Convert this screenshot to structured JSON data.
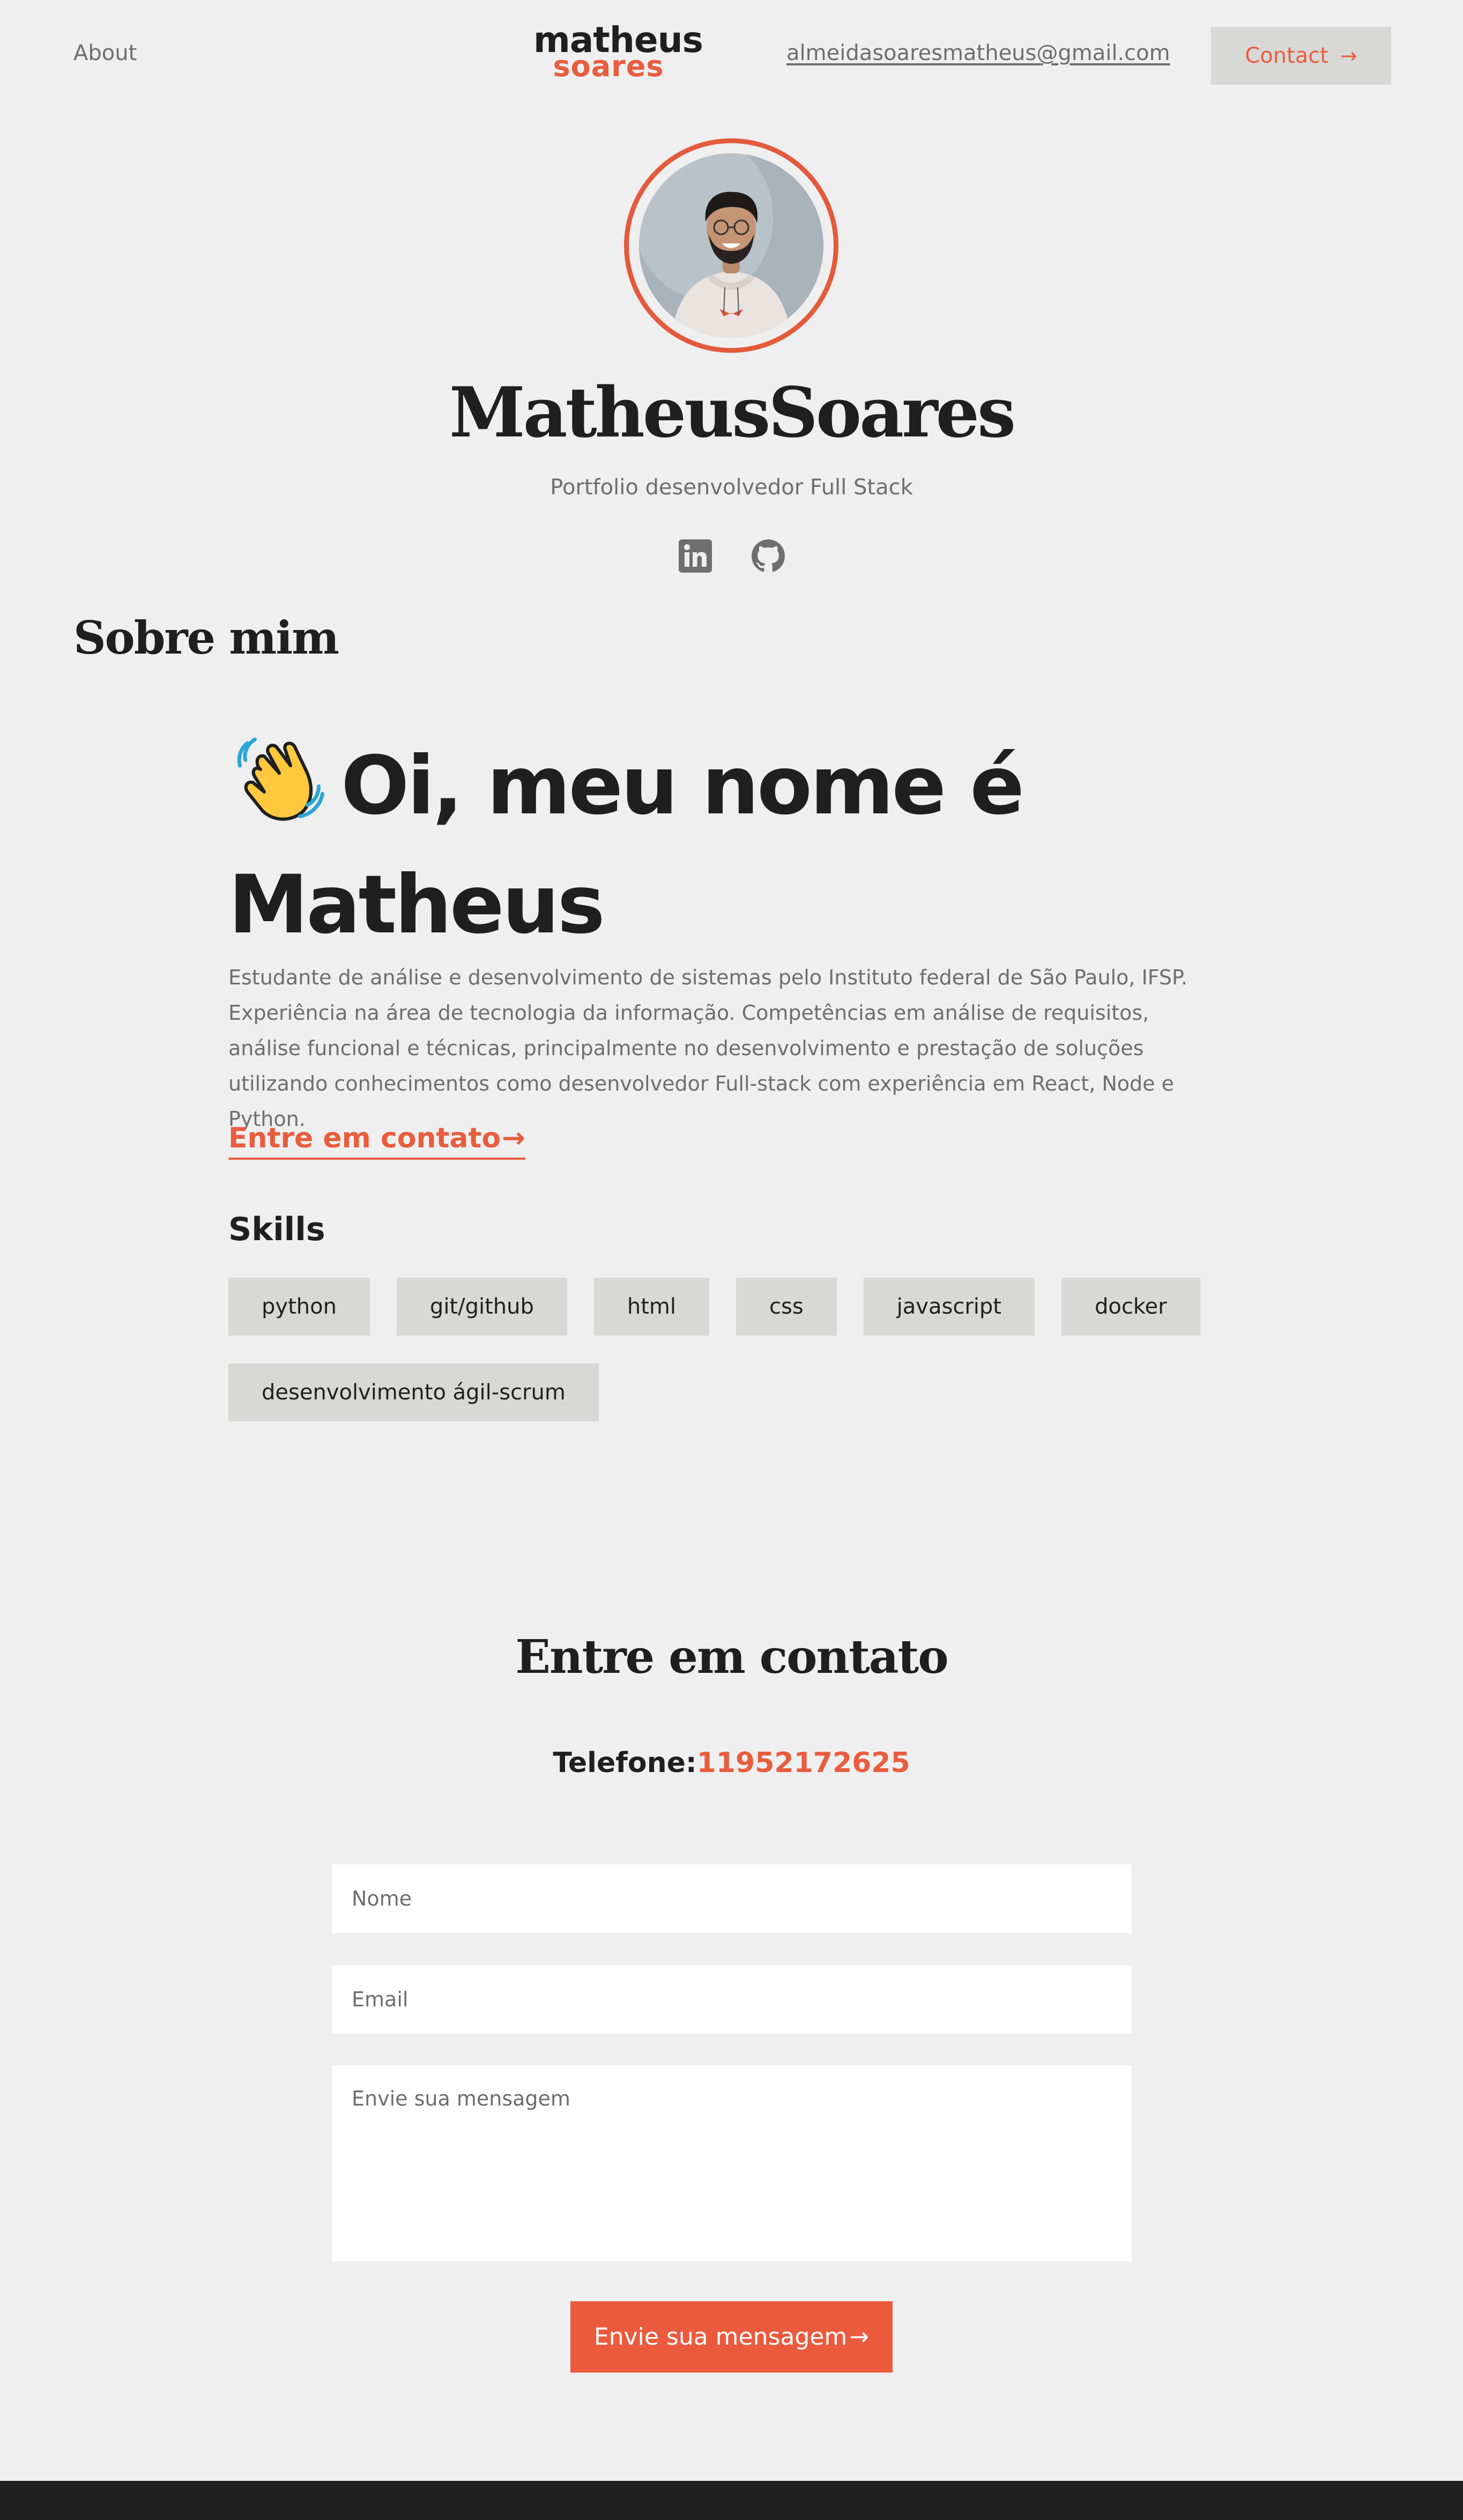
{
  "header": {
    "nav_about": "About",
    "logo_line1": "matheus",
    "logo_line2": "soares",
    "email": "almeidasoaresmatheus@gmail.com",
    "contact_button": "Contact"
  },
  "hero": {
    "name": "MatheusSoares",
    "subtitle": "Portfolio desenvolvedor Full Stack",
    "social_icons": [
      "linkedin-icon",
      "github-icon"
    ]
  },
  "about": {
    "section_title": "Sobre mim",
    "greeting_emoji": "waving-hand",
    "greeting_line1": "Oi, meu nome é",
    "greeting_line2": "Matheus",
    "bio": "Estudante de análise e desenvolvimento de sistemas pelo Instituto federal de São Paulo, IFSP. Experiência na área de tecnologia da informação. Competências em análise de requisitos, análise funcional e técnicas, principalmente no desenvolvimento e prestação de soluções utilizando conhecimentos como desenvolvedor Full-stack com experiência em React, Node e Python.",
    "contact_link": "Entre em contato",
    "skills_title": "Skills",
    "skills": [
      "python",
      "git/github",
      "html",
      "css",
      "javascript",
      "docker",
      "desenvolvimento ágil-scrum"
    ]
  },
  "contact": {
    "title": "Entre em contato",
    "phone_label": "Telefone:",
    "phone_number": "11952172625",
    "name_placeholder": "Nome",
    "email_placeholder": "Email",
    "message_placeholder": "Envie sua mensagem",
    "submit_button": "Envie sua mensagem"
  },
  "colors": {
    "accent": "#e85d3f",
    "background": "#efefef",
    "chip": "#d8d8d6",
    "text_dark": "#1f1f1f",
    "text_muted": "#6e6e6e",
    "footer": "#202020"
  }
}
